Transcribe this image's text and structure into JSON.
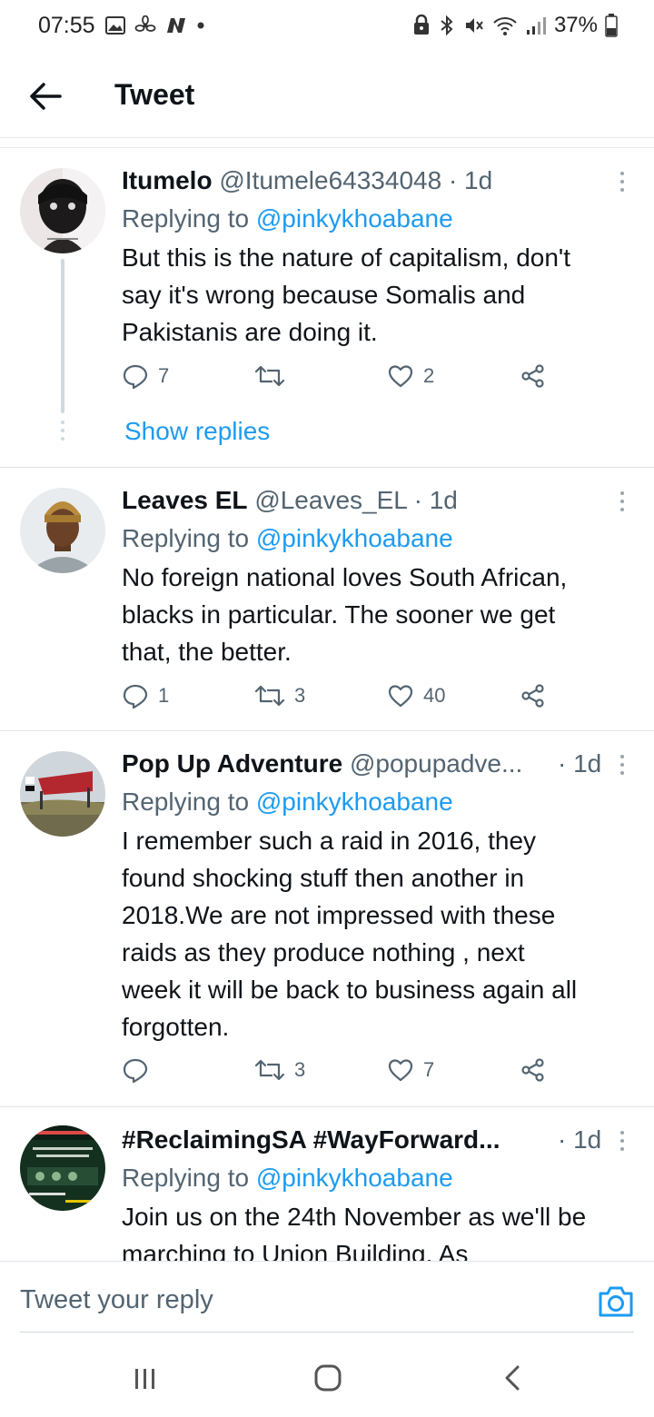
{
  "status_bar": {
    "time": "07:55",
    "battery": "37%",
    "left_icons": [
      "image-icon",
      "fan-icon",
      "n-app-icon",
      "dot-icon"
    ],
    "right_icons": [
      "lock-icon",
      "bluetooth-icon",
      "mute-icon",
      "wifi-icon",
      "signal-icon",
      "battery-icon"
    ]
  },
  "header": {
    "title": "Tweet"
  },
  "tweets": [
    {
      "name": "Itumelo",
      "handle": "@Itumele64334048",
      "time": "· 1d",
      "replying_prefix": "Replying to",
      "replying_to": "@pinkykhoabane",
      "text_lines": [
        "But this is the nature of capitalism, don't",
        "say it's wrong because Somalis and",
        "Pakistanis are doing it."
      ],
      "replies": "7",
      "retweets": "",
      "likes": "2",
      "show_replies": "Show replies"
    },
    {
      "name": "Leaves EL",
      "handle": "@Leaves_EL",
      "time": "· 1d",
      "replying_prefix": "Replying to",
      "replying_to": "@pinkykhoabane",
      "text_lines": [
        "No foreign national loves South African,",
        "blacks in particular. The sooner we get",
        "that, the better."
      ],
      "replies": "1",
      "retweets": "3",
      "likes": "40"
    },
    {
      "name": "Pop Up Adventure",
      "handle": "@popupadve...",
      "time": "· 1d",
      "replying_prefix": "Replying to",
      "replying_to": "@pinkykhoabane",
      "text_lines": [
        "I remember such a raid in  2016, they",
        "found shocking stuff then another in",
        "2018.We are not impressed with these",
        "raids as they produce nothing , next",
        "week it will be back to business again all",
        "forgotten."
      ],
      "replies": "",
      "retweets": "3",
      "likes": "7"
    },
    {
      "name": "#ReclaimingSA #WayForward...",
      "handle": "",
      "time": "· 1d",
      "replying_prefix": "Replying to",
      "replying_to": "@pinkykhoabane",
      "text_lines": [
        "Join us on the 24th November as we'll be",
        "marching to Union Building. As"
      ]
    }
  ],
  "reply_bar": {
    "placeholder": "Tweet your reply"
  },
  "colors": {
    "accent": "#1d9bf0",
    "text": "#0f1419",
    "muted": "#536471",
    "like": "#536471"
  }
}
